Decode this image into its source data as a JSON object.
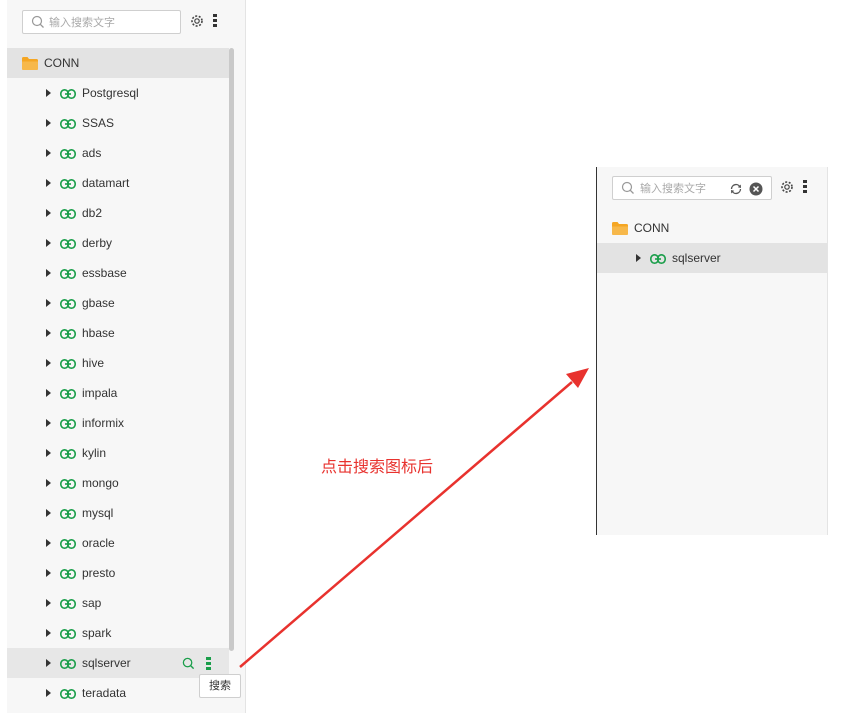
{
  "left": {
    "search_placeholder": "输入搜索文字",
    "root_label": "CONN",
    "items": [
      "Postgresql",
      "SSAS",
      "ads",
      "datamart",
      "db2",
      "derby",
      "essbase",
      "gbase",
      "hbase",
      "hive",
      "impala",
      "informix",
      "kylin",
      "mongo",
      "mysql",
      "oracle",
      "presto",
      "sap",
      "spark",
      "sqlserver",
      "teradata"
    ],
    "selected_item": "sqlserver",
    "tooltip": "搜索"
  },
  "annotation": {
    "caption": "点击搜索图标后",
    "color": "#e8322e"
  },
  "right": {
    "search_placeholder": "输入搜索文字",
    "root_label": "CONN",
    "items": [
      "sqlserver"
    ]
  },
  "colors": {
    "accent_green": "#1a9e4a",
    "folder_orange": "#f5a623",
    "selected_bg": "#e3e3e3"
  },
  "icons": [
    "search-icon",
    "gear-icon",
    "more-icon",
    "folder-icon",
    "link-icon",
    "caret-right-icon",
    "refresh-icon",
    "clear-icon"
  ]
}
